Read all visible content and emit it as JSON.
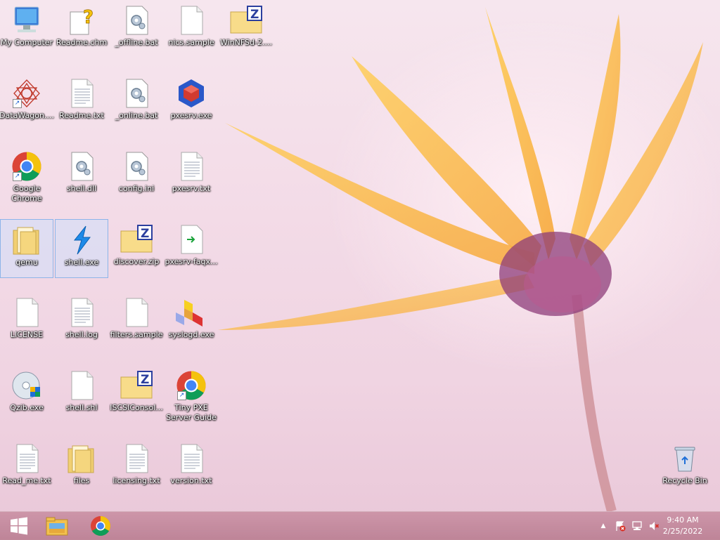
{
  "desktop": {
    "icons": [
      {
        "label": "My Computer",
        "icon": "computer-icon"
      },
      {
        "label": "Readme.chm",
        "icon": "help-file-icon"
      },
      {
        "label": "_offline.bat",
        "icon": "batch-file-icon"
      },
      {
        "label": "nics.sample",
        "icon": "blank-file-icon"
      },
      {
        "label": "WinNFSd-2....",
        "icon": "zip-folder-icon"
      },
      {
        "label": "DataWagon....",
        "icon": "datawagon-icon"
      },
      {
        "label": "Readme.txt",
        "icon": "text-file-icon"
      },
      {
        "label": "_online.bat",
        "icon": "batch-file-icon"
      },
      {
        "label": "pxesrv.exe",
        "icon": "pxesrv-app-icon"
      },
      {
        "label": "Google Chrome",
        "icon": "chrome-icon"
      },
      {
        "label": "shell.dll",
        "icon": "dll-file-icon"
      },
      {
        "label": "config.ini",
        "icon": "ini-file-icon"
      },
      {
        "label": "pxesrv.txt",
        "icon": "text-file-icon"
      },
      {
        "label": "qemu",
        "icon": "folder-icon"
      },
      {
        "label": "shell.exe",
        "icon": "shell-app-icon"
      },
      {
        "label": "discover.zip",
        "icon": "zip-folder-icon"
      },
      {
        "label": "pxesrv-faqx...",
        "icon": "shortcut-file-icon"
      },
      {
        "label": "LICENSE",
        "icon": "blank-file-icon"
      },
      {
        "label": "shell.log",
        "icon": "text-file-icon"
      },
      {
        "label": "filters.sample",
        "icon": "blank-file-icon"
      },
      {
        "label": "syslogd.exe",
        "icon": "syslogd-app-icon"
      },
      {
        "label": "Qzib.exe",
        "icon": "disc-installer-icon"
      },
      {
        "label": "shell.shl",
        "icon": "blank-file-icon"
      },
      {
        "label": "ISCSIConsol...",
        "icon": "zip-folder-icon"
      },
      {
        "label": "Tiny PXE Server Guide",
        "icon": "chrome-icon"
      },
      {
        "label": "Read_me.txt",
        "icon": "text-file-icon"
      },
      {
        "label": "files",
        "icon": "folder-icon"
      },
      {
        "label": "licensing.txt",
        "icon": "text-file-icon"
      },
      {
        "label": "version.txt",
        "icon": "text-file-icon"
      },
      {
        "label": "Recycle Bin",
        "icon": "recycle-bin-icon"
      }
    ]
  },
  "taskbar": {
    "start": {
      "icon": "windows-start-icon"
    },
    "pinned": [
      {
        "icon": "file-explorer-icon"
      },
      {
        "icon": "chrome-icon"
      }
    ],
    "tray": [
      {
        "icon": "show-hidden-icons-icon"
      },
      {
        "icon": "action-center-flag-icon"
      },
      {
        "icon": "network-icon"
      },
      {
        "icon": "volume-muted-icon"
      }
    ],
    "clock": {
      "time": "9:40 AM",
      "date": "2/25/2022"
    }
  },
  "colors": {
    "accent": "#1a73e8",
    "taskbar": "#c48a9c"
  }
}
